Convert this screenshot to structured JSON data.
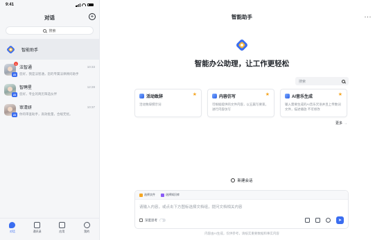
{
  "status_bar": {
    "time": "9:41"
  },
  "sidebar": {
    "title": "对话",
    "search_placeholder": "搜索",
    "assistant": {
      "name": "智能助手"
    },
    "chats": [
      {
        "name": "法智通",
        "time": "10:33",
        "preview": "您好，我是法智通，您的专属法律顾问助手",
        "unread": "1",
        "badge": "AI"
      },
      {
        "name": "智聘星",
        "time": "12:28",
        "preview": "您好，专业的简历筛选伙伴",
        "badge": "AI"
      },
      {
        "name": "审清妍",
        "time": "10:37",
        "preview": "你的审查助手，高效批量，合规无忧。",
        "badge": "AI"
      }
    ],
    "tabs": [
      {
        "label": "对话",
        "active": true
      },
      {
        "label": "通讯录"
      },
      {
        "label": "应用"
      },
      {
        "label": "我的"
      }
    ]
  },
  "main": {
    "title": "智能助手",
    "slogan": "智能办公助理，让工作更轻松",
    "card_search_placeholder": "搜索",
    "cards": [
      {
        "title": "活动致辞",
        "desc": "活动致辞撰示词"
      },
      {
        "title": "内容仿写",
        "desc": "可根据提供的文件内容，以五篇写要束，进行内容仿写"
      },
      {
        "title": "AI音乐生成",
        "desc": "输入需要生成的AI音乐咒语并且上传数词文件，描述播放 不可修改"
      }
    ],
    "more_label": "更多",
    "new_chat_label": "新建会话",
    "composer": {
      "chip_file": "选择文件",
      "chip_kb": "选择知识库",
      "placeholder": "请输入内容，或点击下方图标选择文档组，提问文档相关内容",
      "deep_think_label": "深度思考"
    },
    "footer_note": "内容由AI生成，仅供参考，请核实重要数据和事实内容"
  }
}
